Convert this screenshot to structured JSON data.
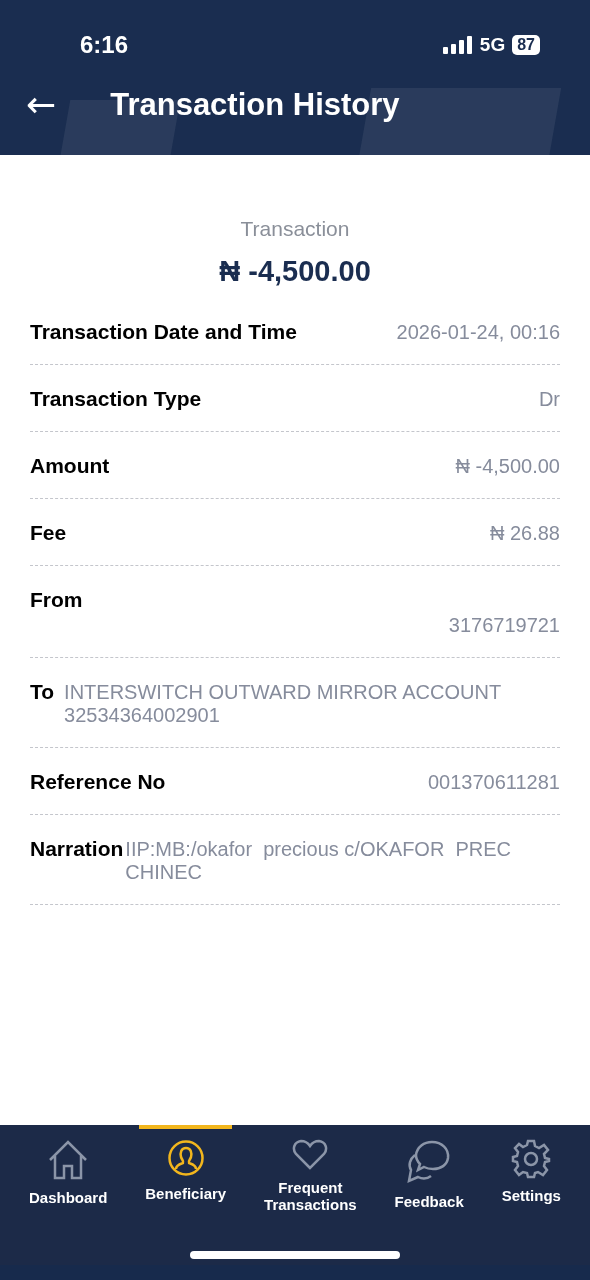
{
  "status_bar": {
    "time": "6:16",
    "network": "5G",
    "battery": "87"
  },
  "header": {
    "back": "←",
    "title": "Transaction History"
  },
  "summary": {
    "label": "Transaction",
    "amount": "₦ -4,500.00"
  },
  "details": [
    {
      "kind": "inline",
      "label": "Transaction Date and Time",
      "value": "2026-01-24, 00:16"
    },
    {
      "kind": "inline",
      "label": "Transaction Type",
      "value": "Dr"
    },
    {
      "kind": "inline",
      "label": "Amount",
      "value": "₦ -4,500.00"
    },
    {
      "kind": "inline",
      "label": "Fee",
      "value": "₦ 26.88"
    },
    {
      "kind": "stacked",
      "label": "From",
      "value": "3176719721"
    },
    {
      "kind": "wrap",
      "label": "To",
      "value_lines": [
        "INTERSWITCH OUTWARD MIRROR ACCOUNT",
        "32534364002901"
      ]
    },
    {
      "kind": "inline",
      "label": "Reference No",
      "value": "001370611281"
    },
    {
      "kind": "wrap",
      "label": "Narration",
      "value_lines": [
        "IIP:MB:/okafor  precious c/OKAFOR  PREC",
        "CHINEC"
      ]
    }
  ],
  "nav": [
    {
      "kind": "home",
      "lines": [
        "Dashboard"
      ],
      "selected": false
    },
    {
      "kind": "person",
      "lines": [
        "Beneficiary"
      ],
      "selected": true
    },
    {
      "kind": "heart",
      "lines": [
        "Frequent",
        "Transactions"
      ],
      "selected": false
    },
    {
      "kind": "chat",
      "lines": [
        "Feedback"
      ],
      "selected": false
    },
    {
      "kind": "gear",
      "lines": [
        "Settings"
      ],
      "selected": false
    }
  ]
}
